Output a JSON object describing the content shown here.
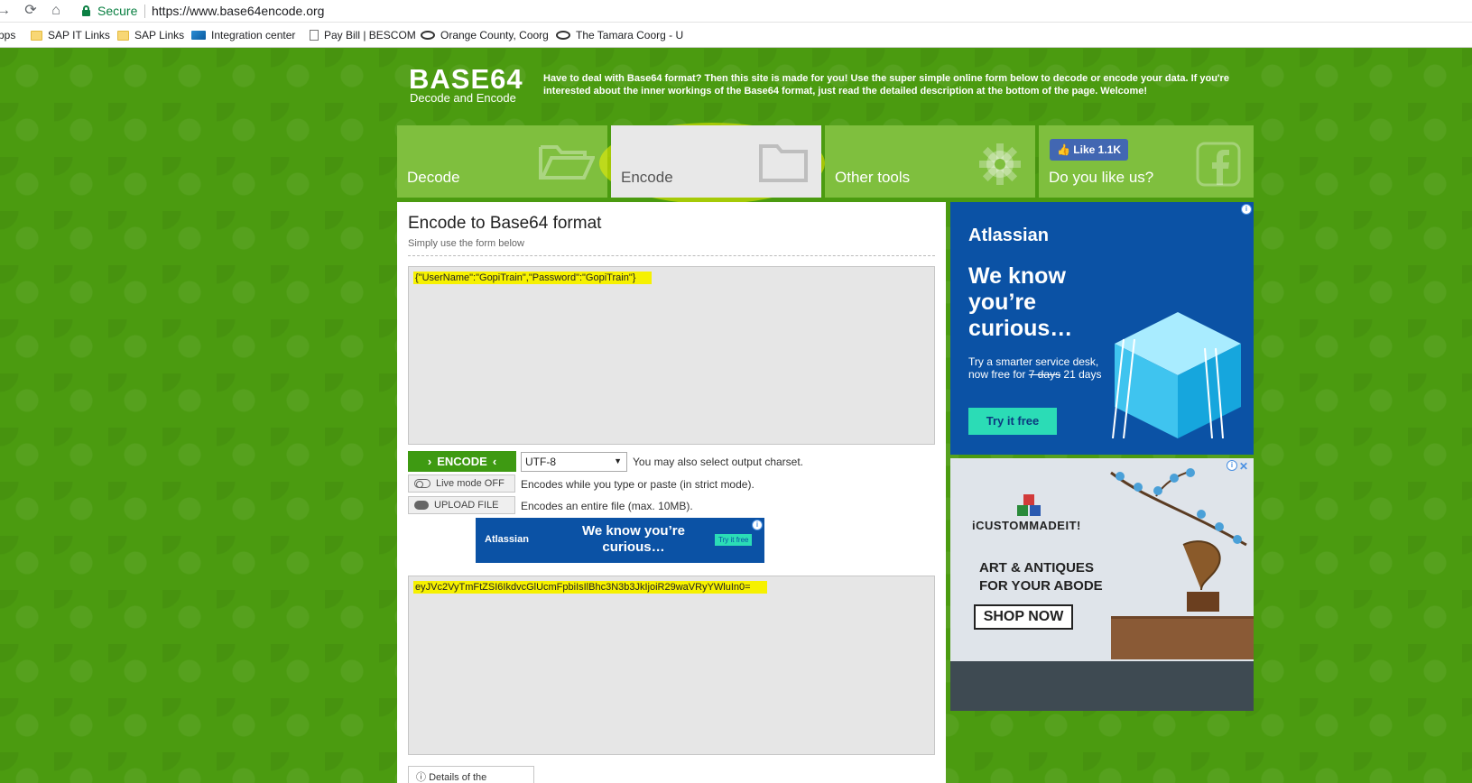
{
  "browser": {
    "secure_label": "Secure",
    "url": "https://www.base64encode.org",
    "bookmarks": [
      {
        "label": "pps"
      },
      {
        "label": "SAP IT Links"
      },
      {
        "label": "SAP Links"
      },
      {
        "label": "Integration center"
      },
      {
        "label": "Pay Bill | BESCOM"
      },
      {
        "label": "Orange County, Coorg"
      },
      {
        "label": "The Tamara Coorg - U"
      }
    ]
  },
  "header": {
    "logo_title": "BASE64",
    "logo_subtitle": "Decode and Encode",
    "intro": "Have to deal with Base64 format? Then this site is made for you! Use the super simple online form below to decode or encode your data. If you're interested about the inner workings of the Base64 format, just read the detailed description at the bottom of the page. Welcome!"
  },
  "tabs": [
    {
      "label": "Decode"
    },
    {
      "label": "Encode"
    },
    {
      "label": "Other tools"
    },
    {
      "label": "Do you like us?"
    }
  ],
  "fb_like_label": "Like 1.1K",
  "form": {
    "title": "Encode to Base64 format",
    "subtitle": "Simply use the form below",
    "input_value": "{\"UserName\":\"GopiTrain\",\"Password\":\"GopiTrain\"}",
    "encode_label": "ENCODE",
    "charset_value": "UTF-8",
    "charset_note": "You may also select output charset.",
    "live_mode_label": "Live mode OFF",
    "live_mode_note": "Encodes while you type or paste (in strict mode).",
    "upload_label": "UPLOAD FILE",
    "upload_note": "Encodes an entire file (max. 10MB).",
    "output_value": "eyJVc2VyTmFtZSI6IkdvcGlUcmFpbiIsIlBhc3N3b3JkIjoiR29waVRyYWluIn0=",
    "details_label": "Details of the encoding"
  },
  "mini_ad": {
    "brand": "Atlassian",
    "text": "We know you’re curious…",
    "cta": "Try it free"
  },
  "ad_atlassian": {
    "brand": "Atlassian",
    "headline": "We know you’re curious…",
    "body_prefix": "Try a smarter service desk, now free for",
    "old_days": "7 days",
    "new_days": "21 days",
    "cta": "Try it free"
  },
  "ad_custom": {
    "brand": "iCUSTOMMADEIT!",
    "headline_1": "ART & ANTIQUES",
    "headline_2": "FOR YOUR ABODE",
    "cta": "SHOP NOW"
  },
  "colors": {
    "page_green": "#4b9b10",
    "tab_green": "#7fbf3e",
    "button_green": "#3e9a12",
    "ad_blue": "#0b52a5",
    "highlight": "#f6f100"
  }
}
